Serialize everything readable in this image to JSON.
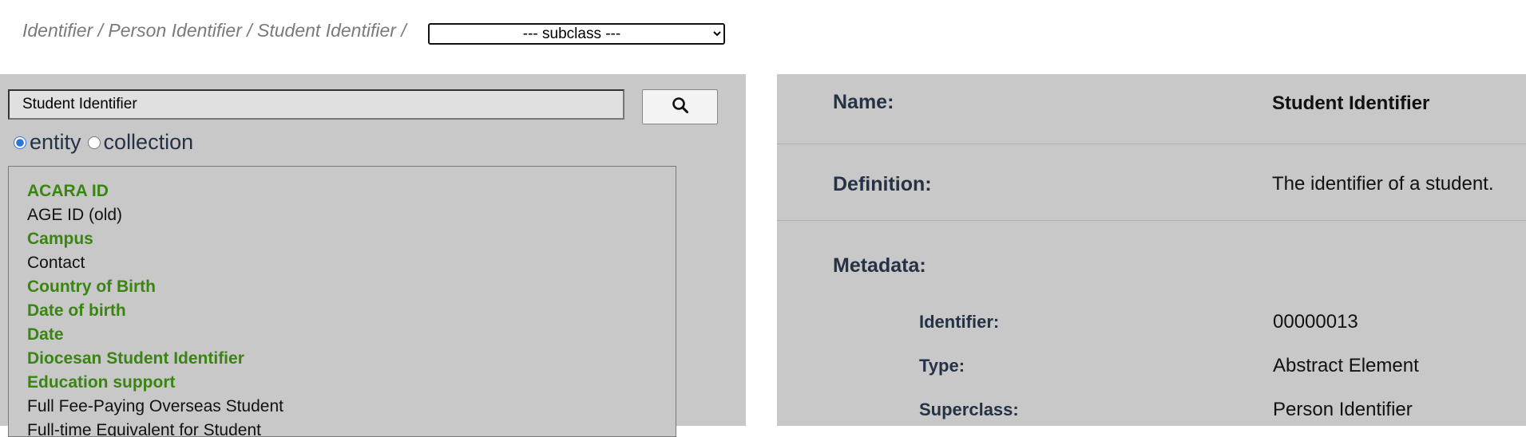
{
  "breadcrumb": {
    "path": "Identifier / Person Identifier / Student Identifier /"
  },
  "subclass_select": {
    "selected": "--- subclass ---"
  },
  "search": {
    "value": "Student Identifier",
    "button_icon": "search-icon"
  },
  "mode": {
    "options": [
      {
        "label": "entity",
        "checked": true
      },
      {
        "label": "collection",
        "checked": false
      }
    ]
  },
  "entity_list": {
    "items": [
      {
        "label": "ACARA ID",
        "style": "green"
      },
      {
        "label": "AGE ID (old)",
        "style": "plain"
      },
      {
        "label": "Campus",
        "style": "green"
      },
      {
        "label": "Contact",
        "style": "plain"
      },
      {
        "label": "Country of Birth",
        "style": "green"
      },
      {
        "label": "Date of birth",
        "style": "green"
      },
      {
        "label": "Date",
        "style": "green"
      },
      {
        "label": "Diocesan Student Identifier",
        "style": "green"
      },
      {
        "label": "Education support",
        "style": "green"
      },
      {
        "label": "Full Fee-Paying Overseas Student",
        "style": "plain"
      },
      {
        "label": "Full-time Equivalent for Student",
        "style": "plain"
      }
    ]
  },
  "detail": {
    "name_label": "Name:",
    "name_value": "Student Identifier",
    "definition_label": "Definition:",
    "definition_value": "The identifier of a student.",
    "metadata_label": "Metadata:",
    "metadata": [
      {
        "label": "Identifier:",
        "value": "00000013"
      },
      {
        "label": "Type:",
        "value": "Abstract Element"
      },
      {
        "label": "Superclass:",
        "value": "Person Identifier"
      }
    ]
  },
  "colors": {
    "panel_bg": "#c8c8c8",
    "link_green": "#3a8512",
    "label_navy": "#253246",
    "breadcrumb_gray": "#7a7a7a"
  }
}
